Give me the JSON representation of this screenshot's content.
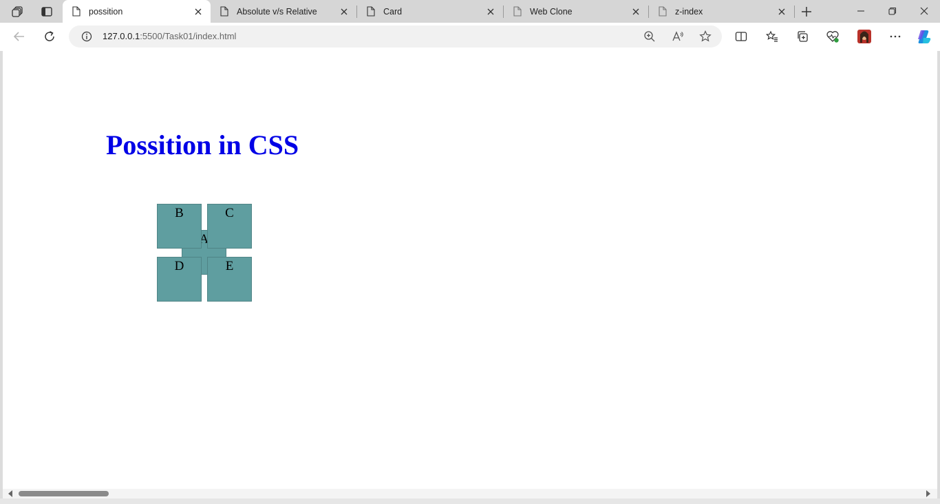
{
  "browser": {
    "tabs": [
      {
        "title": "possition",
        "active": true
      },
      {
        "title": "Absolute v/s Relative",
        "active": false
      },
      {
        "title": "Card",
        "active": false
      },
      {
        "title": "Web Clone",
        "active": false
      },
      {
        "title": "z-index",
        "active": false
      }
    ],
    "url_host": "127.0.0.1",
    "url_path": ":5500/Task01/index.html",
    "icons": {
      "workspaces": "workspaces-icon",
      "tab_actions": "tab-actions-icon",
      "new_tab": "plus-icon",
      "minimize": "minimize-icon",
      "restore": "restore-icon",
      "close": "close-icon",
      "back": "back-arrow-icon",
      "refresh": "refresh-icon",
      "info": "info-icon",
      "zoom": "zoom-icon",
      "read_aloud": "read-aloud-icon",
      "favorite": "star-icon",
      "split_screen": "split-screen-icon",
      "favorites": "favorites-icon",
      "collections": "collections-icon",
      "browser_essentials": "heart-pulse-icon",
      "profile": "avatar",
      "more": "more-icon",
      "copilot": "copilot-icon"
    }
  },
  "page": {
    "heading": "Possition in CSS",
    "boxes": {
      "a": "A",
      "b": "B",
      "c": "C",
      "d": "D",
      "e": "E"
    },
    "colors": {
      "heading": "#0000e6",
      "box": "#5f9ea0"
    }
  }
}
